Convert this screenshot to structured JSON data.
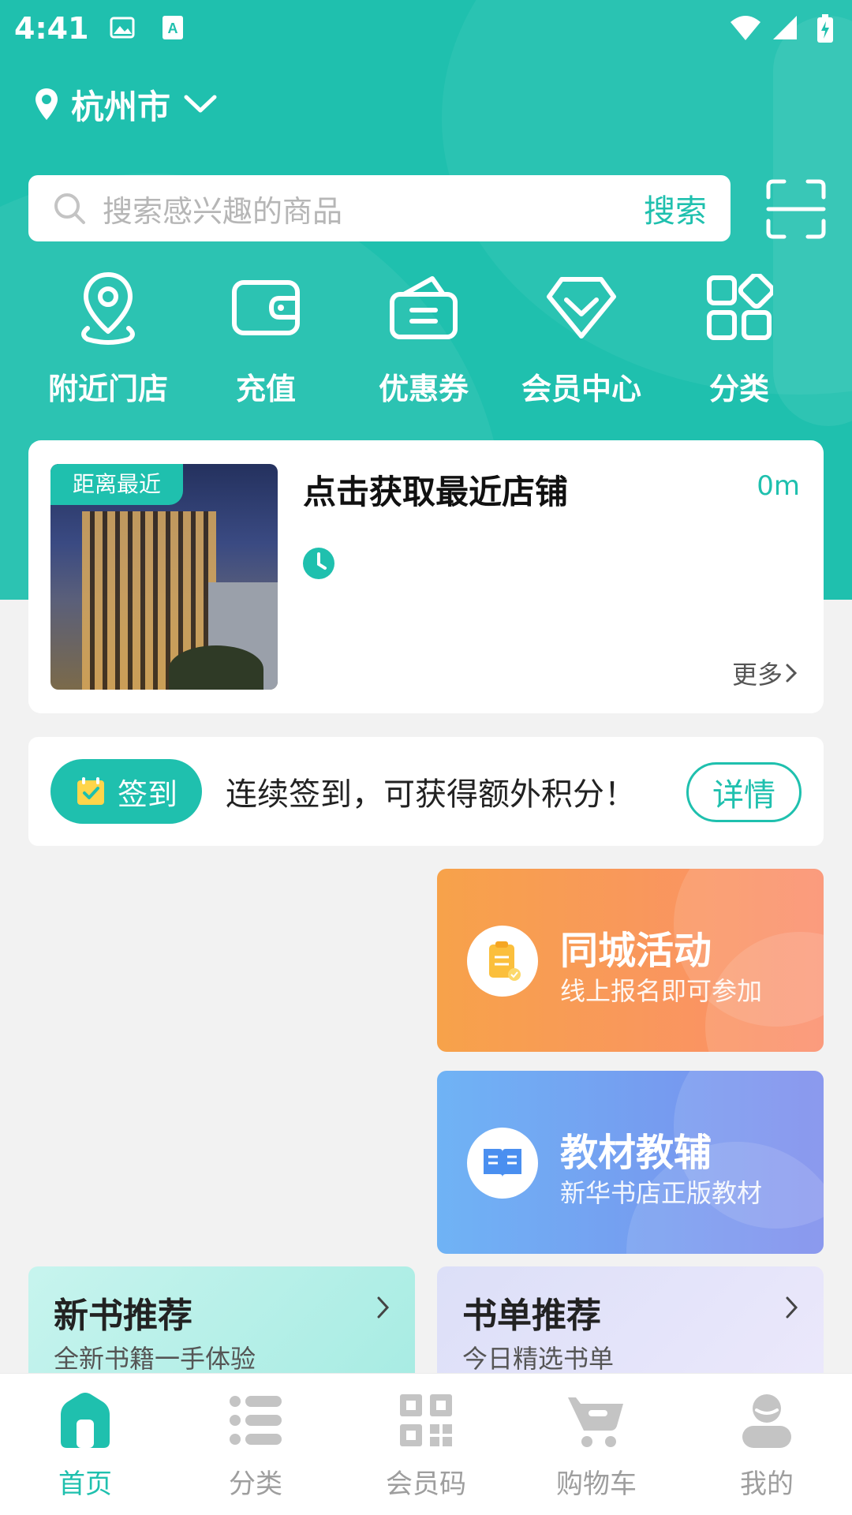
{
  "status_bar": {
    "time": "4:41"
  },
  "header": {
    "city": "杭州市"
  },
  "search": {
    "placeholder": "搜索感兴趣的商品",
    "button": "搜索"
  },
  "quick_menu": [
    {
      "label": "附近门店",
      "icon": "location-pin-icon"
    },
    {
      "label": "充值",
      "icon": "wallet-icon"
    },
    {
      "label": "优惠券",
      "icon": "coupon-icon"
    },
    {
      "label": "会员中心",
      "icon": "diamond-icon"
    },
    {
      "label": "分类",
      "icon": "category-grid-icon"
    }
  ],
  "store_card": {
    "tag": "距离最近",
    "title": "点击获取最近店铺",
    "distance": "0m",
    "more": "更多"
  },
  "signin": {
    "button": "签到",
    "message": "连续签到，可获得额外积分！",
    "detail": "详情"
  },
  "promo_cards": [
    {
      "title": "同城活动",
      "subtitle": "线上报名即可参加"
    },
    {
      "title": "教材教辅",
      "subtitle": "新华书店正版教材"
    }
  ],
  "recommend": [
    {
      "title": "新书推荐",
      "subtitle": "全新书籍一手体验"
    },
    {
      "title": "书单推荐",
      "subtitle": "今日精选书单"
    }
  ],
  "tabbar": [
    {
      "label": "首页",
      "active": true
    },
    {
      "label": "分类"
    },
    {
      "label": "会员码"
    },
    {
      "label": "购物车"
    },
    {
      "label": "我的"
    }
  ],
  "colors": {
    "primary": "#1fc0ae",
    "activity": "#f7a24a",
    "edu": "#7b8bec"
  }
}
